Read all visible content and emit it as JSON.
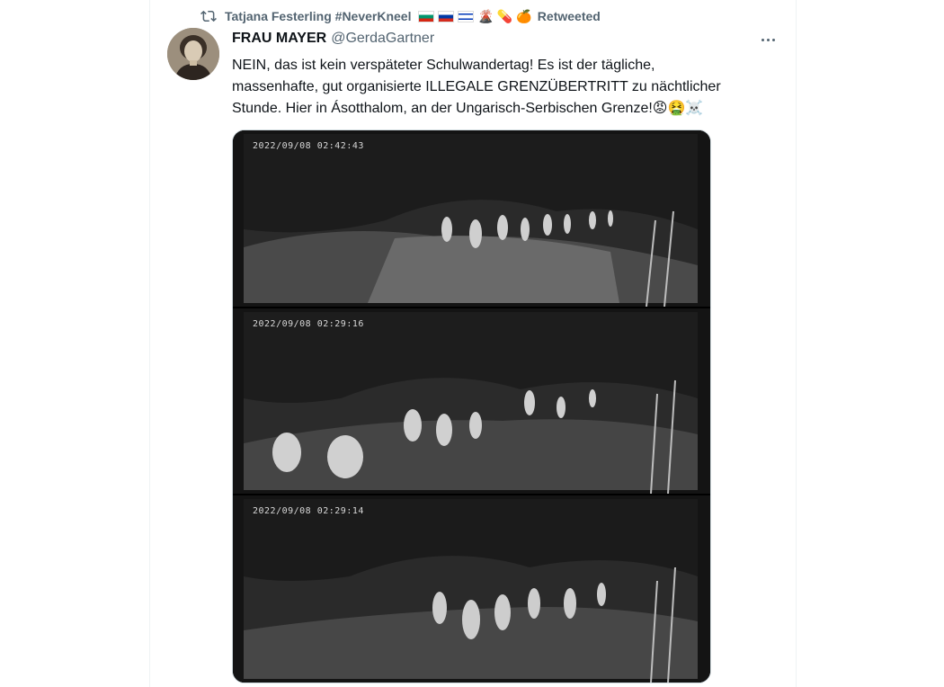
{
  "retweet": {
    "icon": "retweet-icon",
    "user": "Tatjana Festerling #NeverKneel",
    "flags": [
      "bulgaria-flag",
      "russia-flag",
      "israel-flag"
    ],
    "emojis": [
      "🌋",
      "💊",
      "🍊"
    ],
    "suffix": "Retweeted"
  },
  "tweet": {
    "author_name": "FRAU MAYER",
    "author_handle": "@GerdaGartner",
    "text_line1": "NEIN, das ist kein verspäteter Schulwandertag! Es ist der tägliche,",
    "text_line2": "massenhafte, gut organisierte ILLEGALE GRENZÜBERTRITT zu nächtlicher",
    "text_line3": "Stunde. Hier in Ásotthalom, an der Ungarisch-Serbischen Grenze!",
    "text_emojis": [
      "😡",
      "🤮",
      "☠️"
    ]
  },
  "media": {
    "frames": [
      {
        "timestamp": "2022/09/08  02:42:43"
      },
      {
        "timestamp": "2022/09/08  02:29:16"
      },
      {
        "timestamp": "2022/09/08  02:29:14"
      }
    ]
  }
}
